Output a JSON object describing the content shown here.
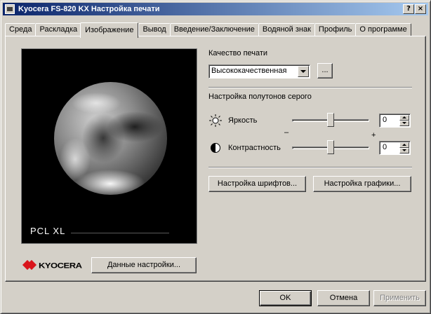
{
  "window": {
    "title": "Kyocera FS-820 KX Настройка печати",
    "help_glyph": "?",
    "close_glyph": "×"
  },
  "tabs": [
    {
      "label": "Среда",
      "active": false
    },
    {
      "label": "Раскладка",
      "active": false
    },
    {
      "label": "Изображение",
      "active": true
    },
    {
      "label": "Вывод",
      "active": false
    },
    {
      "label": "Введение/Заключение",
      "active": false
    },
    {
      "label": "Водяной знак",
      "active": false
    },
    {
      "label": "Профиль",
      "active": false
    },
    {
      "label": "О программе",
      "active": false
    }
  ],
  "preview": {
    "label": "PCL XL"
  },
  "logo": {
    "text": "KYOCERA"
  },
  "settings_data_button": "Данные настройки...",
  "print_quality": {
    "label": "Качество печати",
    "selected": "Высококачественная",
    "more_button": "..."
  },
  "halftone": {
    "label": "Настройка полутонов серого",
    "brightness": {
      "label": "Яркость",
      "value": "0",
      "slider_level": 0.5
    },
    "contrast": {
      "label": "Контрастность",
      "value": "0",
      "slider_level": 0.5
    },
    "minus": "–",
    "plus": "+"
  },
  "buttons": {
    "fonts": "Настройка шрифтов...",
    "graphics": "Настройка графики...",
    "ok": "OK",
    "cancel": "Отмена",
    "apply": "Применить"
  },
  "colors": {
    "titlebar_start": "#0a246a",
    "titlebar_end": "#a6caf0",
    "logo_red": "#d9151c",
    "face": "#d4d0c8"
  },
  "icons": [
    "app-icon",
    "help-icon",
    "close-icon",
    "sun-icon",
    "contrast-icon",
    "kyocera-logo-icon",
    "dropdown-arrow-icon"
  ]
}
